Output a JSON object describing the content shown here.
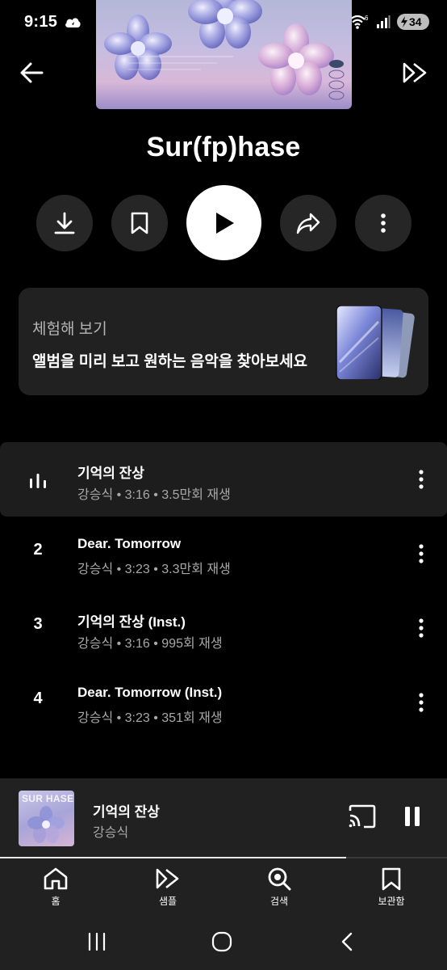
{
  "status_bar": {
    "time": "9:15",
    "battery": "34"
  },
  "album": {
    "title": "Sur(fp)hase",
    "cover_text": "SURFPHASE"
  },
  "promo": {
    "label": "체험해 보기",
    "text": "앨범을 미리 보고 원하는 음악을 찾아보세요"
  },
  "tracks": [
    {
      "index": "",
      "title": "기억의 잔상",
      "meta": "강승식 • 3:16 • 3.5만회 재생",
      "playing": true
    },
    {
      "index": "2",
      "title": "Dear. Tomorrow",
      "meta": "강승식 • 3:23 • 3.3만회 재생",
      "playing": false
    },
    {
      "index": "3",
      "title": "기억의 잔상 (Inst.)",
      "meta": "강승식 • 3:16 • 995회 재생",
      "playing": false
    },
    {
      "index": "4",
      "title": "Dear. Tomorrow (Inst.)",
      "meta": "강승식 • 3:23 • 351회 재생",
      "playing": false
    }
  ],
  "mini_player": {
    "thumb_text": "SUR  HASE",
    "title": "기억의 잔상",
    "artist": "강승식",
    "progress_fraction": 0.775
  },
  "nav": {
    "items": [
      {
        "label": "홈",
        "icon": "home-icon"
      },
      {
        "label": "샘플",
        "icon": "samples-icon"
      },
      {
        "label": "검색",
        "icon": "search-icon"
      },
      {
        "label": "보관함",
        "icon": "library-icon"
      }
    ]
  },
  "colors": {
    "background": "#000000",
    "card": "#212121",
    "active_row": "#1d1d1d",
    "secondary_text": "#a8a8a8"
  }
}
